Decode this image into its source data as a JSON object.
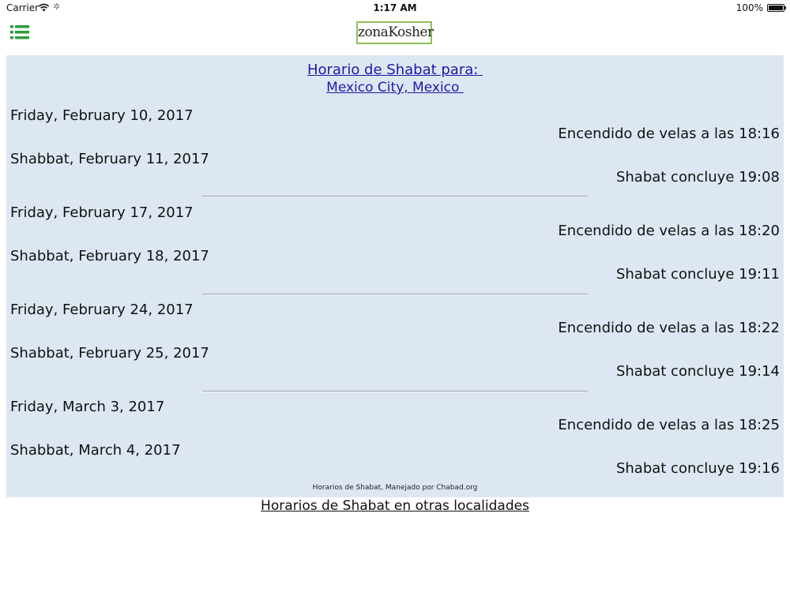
{
  "status_bar": {
    "carrier": "Carrier",
    "time": "1:17 AM",
    "battery": "100%"
  },
  "nav": {
    "menu_icon": "list-icon",
    "logo_text": "zonaKosher",
    "logo_color": "#8fbf5a"
  },
  "schedule": {
    "title": "Horario de Shabat para: ",
    "location": "Mexico City, Mexico ",
    "weeks": [
      {
        "friday": "Friday, February 10, 2017",
        "candle_lighting": "Encendido de velas a las 18:16",
        "shabbat": "Shabbat, February 11, 2017",
        "havdalah": "Shabat concluye 19:08"
      },
      {
        "friday": "Friday, February 17, 2017",
        "candle_lighting": "Encendido de velas a las 18:20",
        "shabbat": "Shabbat, February 18, 2017",
        "havdalah": "Shabat concluye 19:11"
      },
      {
        "friday": "Friday, February 24, 2017",
        "candle_lighting": "Encendido de velas a las 18:22",
        "shabbat": "Shabbat, February 25, 2017",
        "havdalah": "Shabat concluye 19:14"
      },
      {
        "friday": "Friday, March 3, 2017",
        "candle_lighting": "Encendido de velas a las 18:25",
        "shabbat": "Shabbat, March 4, 2017",
        "havdalah": "Shabat concluye 19:16"
      }
    ],
    "credit": "Horarios de Shabat, Manejado por Chabad.org"
  },
  "footer": {
    "other_locations_link": "Horarios de Shabat en otras localidades"
  },
  "colors": {
    "panel_background": "#dde7f3",
    "link_blue": "#1a1aa8",
    "menu_green": "#2e9e3e"
  }
}
